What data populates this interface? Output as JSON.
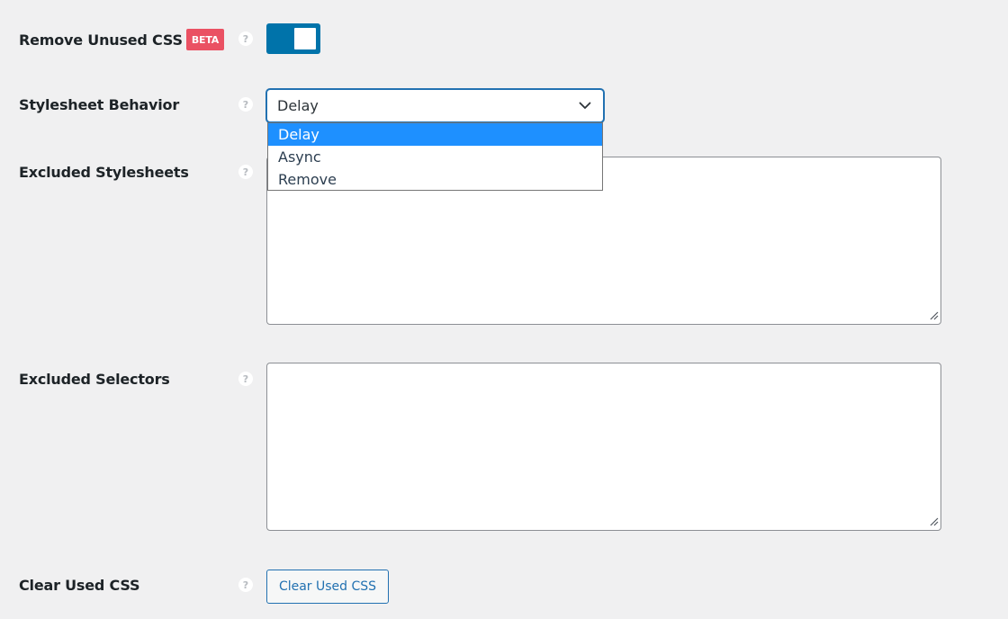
{
  "settings": {
    "remove_unused_css": {
      "label": "Remove Unused CSS",
      "badge": "BETA",
      "help": "?",
      "enabled": true,
      "toggle_color": "#0073aa"
    },
    "stylesheet_behavior": {
      "label": "Stylesheet Behavior",
      "help": "?",
      "selected": "Delay",
      "options": [
        "Delay",
        "Async",
        "Remove"
      ]
    },
    "excluded_stylesheets": {
      "label": "Excluded Stylesheets",
      "help": "?",
      "value": ""
    },
    "excluded_selectors": {
      "label": "Excluded Selectors",
      "help": "?",
      "value": ""
    },
    "clear_used_css": {
      "label": "Clear Used CSS",
      "help": "?",
      "button_label": "Clear Used CSS"
    }
  },
  "colors": {
    "accent": "#2271b1",
    "badge": "#ea5163",
    "option_highlight": "#1e90ff",
    "background": "#f0f0f1"
  }
}
